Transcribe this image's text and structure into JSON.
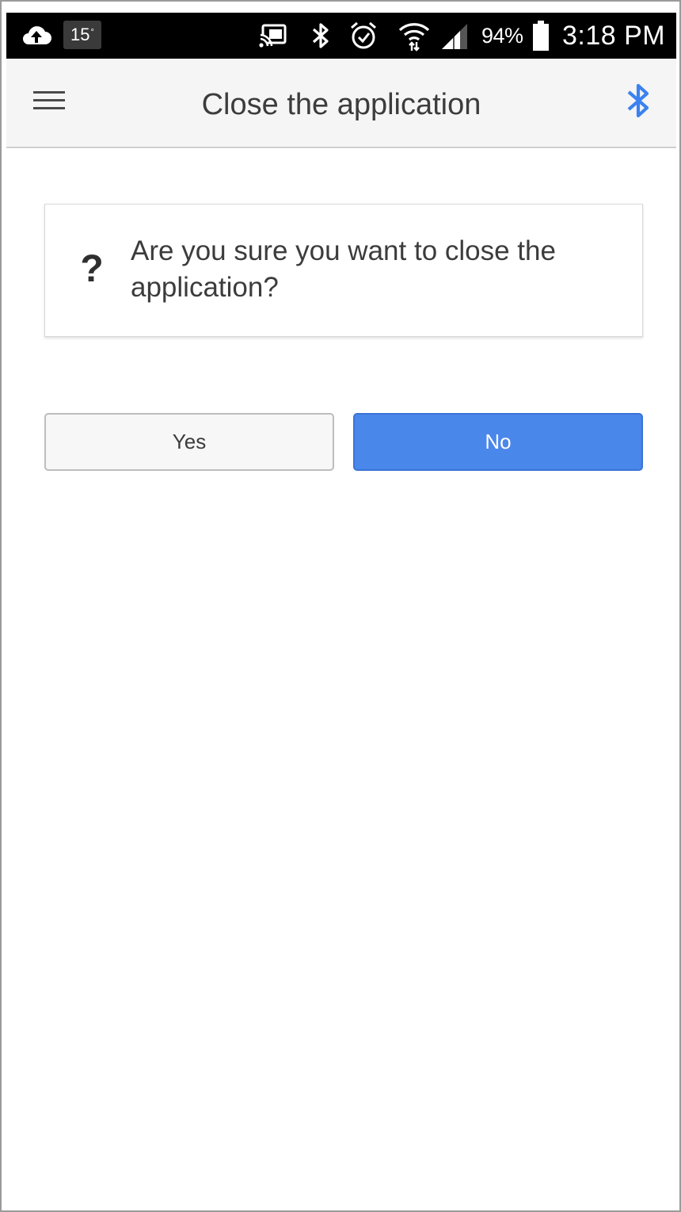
{
  "status_bar": {
    "temperature": "15",
    "temperature_unit": "°",
    "battery_percent": "94%",
    "time": "3:18 PM",
    "icons": [
      "cloud-upload-icon",
      "cast-icon",
      "bluetooth-icon",
      "alarm-icon",
      "wifi-icon",
      "signal-icon",
      "battery-icon"
    ]
  },
  "app_bar": {
    "title": "Close the application",
    "menu_icon": "hamburger-menu-icon",
    "action_icon": "bluetooth-icon"
  },
  "dialog": {
    "icon": "question-mark-icon",
    "icon_glyph": "?",
    "message": "Are you sure you want to close the application?"
  },
  "buttons": {
    "yes_label": "Yes",
    "no_label": "No"
  },
  "colors": {
    "accent": "#4a87ea",
    "bluetooth_icon": "#3b82f0",
    "status_bar_bg": "#000000",
    "app_bar_bg": "#f5f5f5"
  }
}
